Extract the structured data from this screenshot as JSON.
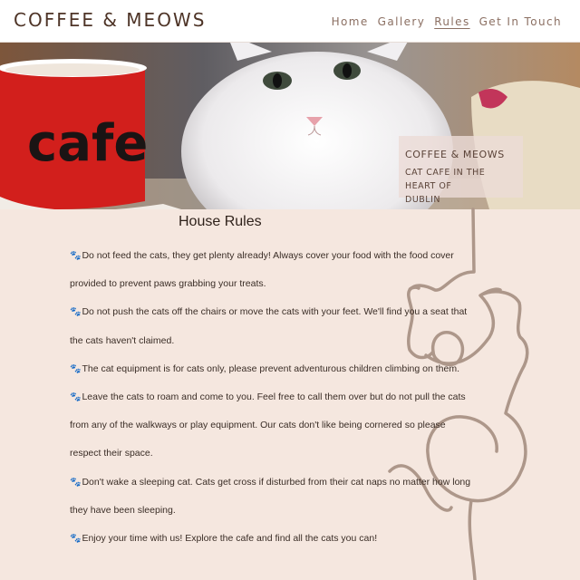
{
  "header": {
    "brand": "COFFEE & MEOWS",
    "nav": [
      "Home",
      "Gallery",
      "Rules",
      "Get In Touch"
    ],
    "active": "Rules"
  },
  "hero": {
    "mug_text": "cafe",
    "card_title": "COFFEE & MEOWS",
    "card_subtitle_line1": "CAT CAFE IN THE HEART OF",
    "card_subtitle_line2": "DUBLIN"
  },
  "rules": {
    "title": "House Rules",
    "bullet_icon": "paw-icon",
    "items": [
      "Do not feed the cats, they get plenty already! Always cover your food with the food cover provided to prevent paws grabbing your treats.",
      "Do not push the cats off the chairs or move the cats with your feet. We'll find you a seat that the cats haven't claimed.",
      "The cat equipment is for cats only, please prevent adventurous children climbing on them.",
      "Leave the cats to roam and come to you. Feel free to call them over but do not pull the cats from any of the walkways or play equipment. Our cats don't like being cornered so please respect their space.",
      "Don't wake a sleeping cat. Cats get cross if disturbed from their cat naps no matter how long they have been sleeping.",
      "Enjoy your time with us! Explore the cafe and find all the cats you can!"
    ]
  },
  "colors": {
    "background": "#f5e7df",
    "brand_text": "#4e3427",
    "line_art": "#ad978a",
    "mug_red": "#d21f1c"
  }
}
